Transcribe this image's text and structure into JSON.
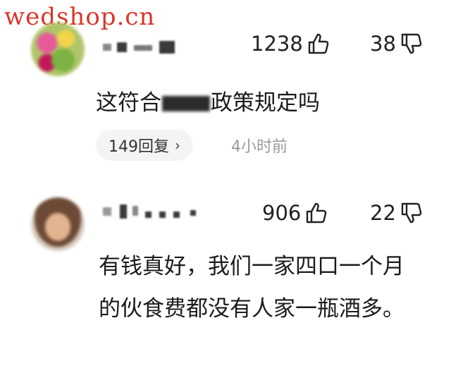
{
  "watermark": "wedshop.cn",
  "comments": [
    {
      "like_count": "1238",
      "dislike_count": "38",
      "text_before": "这符合",
      "text_after": "政策规定吗",
      "replies_label": "149回复",
      "replies_chevron": "›",
      "time": "4小时前"
    },
    {
      "like_count": "906",
      "dislike_count": "22",
      "text": "有钱真好，我们一家四口一个月的伙食费都没有人家一瓶酒多。"
    }
  ],
  "icons": {
    "like": "thumbs-up-icon",
    "dislike": "thumbs-down-icon"
  }
}
